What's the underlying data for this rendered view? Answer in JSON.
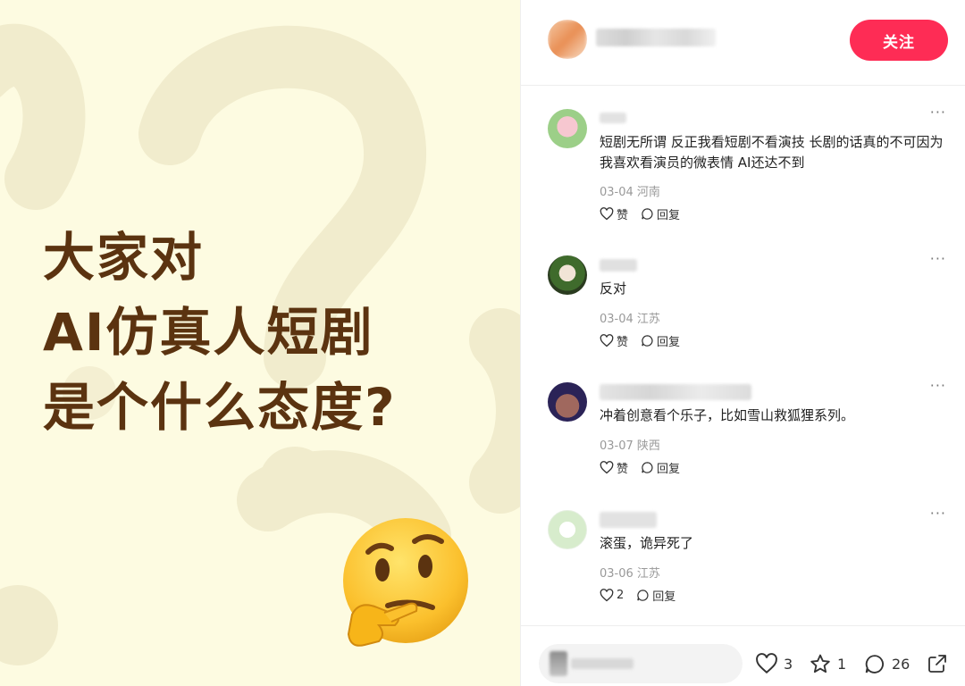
{
  "image": {
    "headline": [
      "大家对",
      "AI仿真人短剧",
      "是个什么态度?"
    ],
    "background_color": "#fdfbe1",
    "headline_color": "#5b3310",
    "emoji": "thinking-face-icon"
  },
  "header": {
    "follow_label": "关注",
    "follow_color": "#fe2c55"
  },
  "comments": [
    {
      "text": "短剧无所谓 反正我看短剧不看演技 长剧的话真的不可因为我喜欢看演员的微表情 AI还达不到",
      "date": "03-04",
      "location": "河南",
      "like_label": "赞",
      "reply_label": "回复"
    },
    {
      "text": "反对",
      "date": "03-04",
      "location": "江苏",
      "like_label": "赞",
      "reply_label": "回复"
    },
    {
      "text": "冲着创意看个乐子，比如雪山救狐狸系列。",
      "date": "03-07",
      "location": "陕西",
      "like_label": "赞",
      "reply_label": "回复"
    },
    {
      "text": "滚蛋，诡异死了",
      "date": "03-06",
      "location": "江苏",
      "like_label": "2",
      "reply_label": "回复"
    }
  ],
  "more_label": "···",
  "bottom": {
    "likes": "3",
    "favorites": "1",
    "comments": "26"
  }
}
